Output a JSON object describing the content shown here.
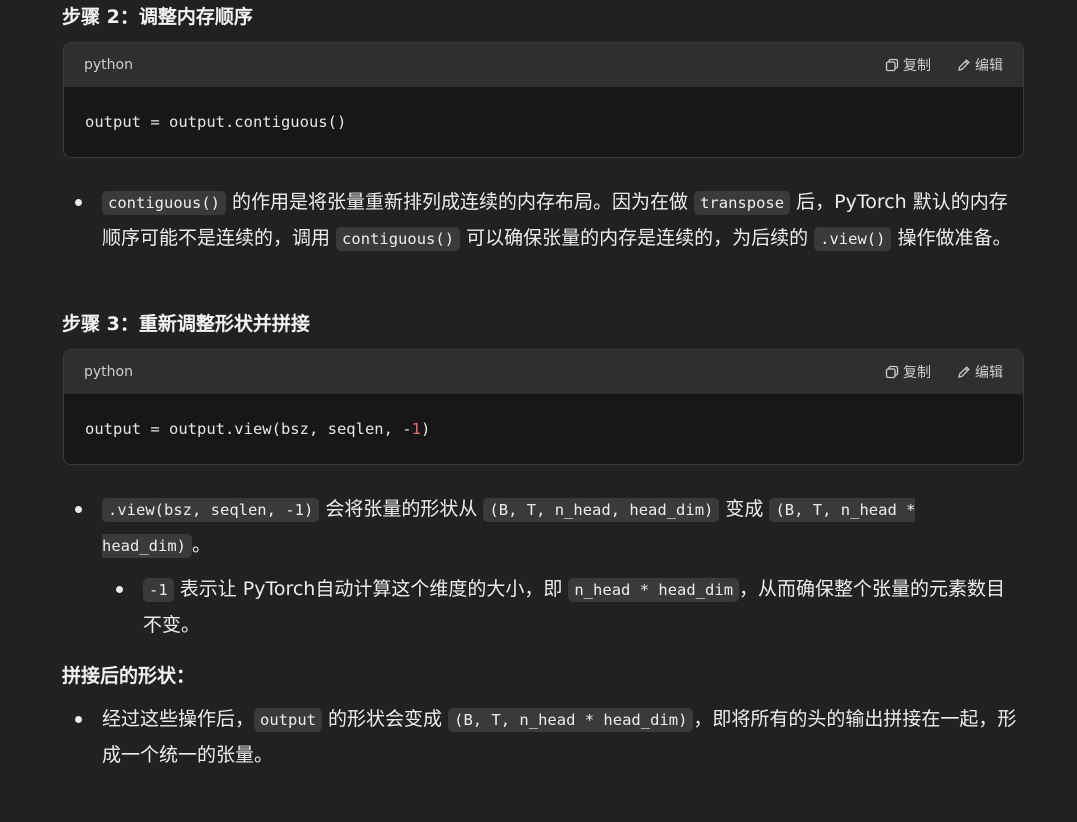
{
  "sections": {
    "step2_heading": "步骤 2：调整内存顺序",
    "step3_heading": "步骤 3：重新调整形状并拼接",
    "after_heading": "拼接后的形状："
  },
  "code1": {
    "lang": "python",
    "copy_label": "复制",
    "edit_label": "编辑",
    "code": "output = output.contiguous()"
  },
  "code2": {
    "lang": "python",
    "copy_label": "复制",
    "edit_label": "编辑",
    "code_prefix": "output = output.view(bsz, seqlen, -",
    "code_num": "1",
    "code_suffix": ")"
  },
  "bullet1": {
    "c1": "contiguous()",
    "t1": " 的作用是将张量重新排列成连续的内存布局。因为在做 ",
    "c2": "transpose",
    "t2": " 后，PyTorch 默认的内存顺序可能不是连续的，调用 ",
    "c3": "contiguous()",
    "t3": " 可以确保张量的内存是连续的，为后续的 ",
    "c4": ".view()",
    "t4": " 操作做准备。"
  },
  "bullet2": {
    "c1": ".view(bsz, seqlen, -1)",
    "t1": " 会将张量的形状从 ",
    "c2": "(B, T, n_head, head_dim)",
    "t2": " 变成 ",
    "c3": "(B, T, n_head * head_dim)",
    "t3": "。"
  },
  "bullet2_sub": {
    "c1": "-1",
    "t1": " 表示让 PyTorch自动计算这个维度的大小，即 ",
    "c2": "n_head * head_dim",
    "t2": "，从而确保整个张量的元素数目不变。"
  },
  "bullet3": {
    "t0": "经过这些操作后，",
    "c1": "output",
    "t1": " 的形状会变成 ",
    "c2": "(B, T, n_head * head_dim)",
    "t2": "，即将所有的头的输出拼接在一起，形成一个统一的张量。"
  }
}
